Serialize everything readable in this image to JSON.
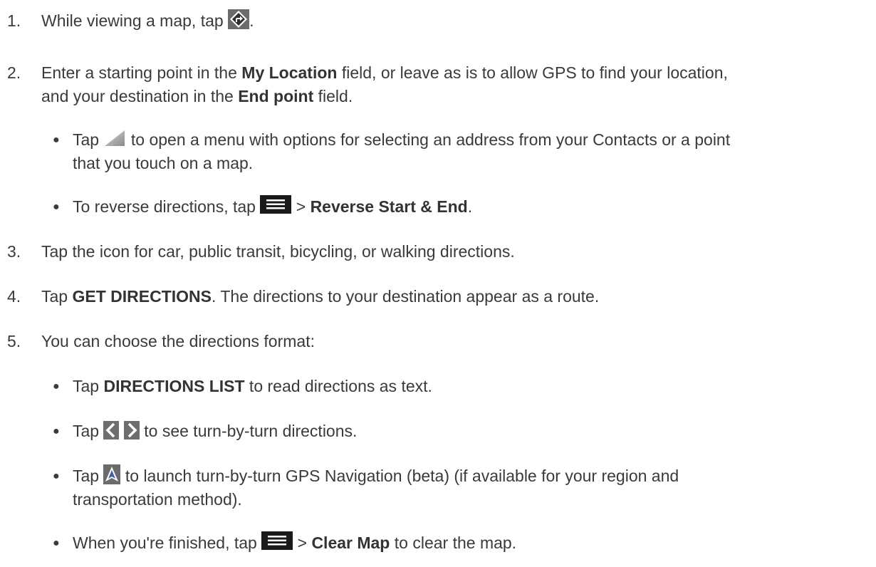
{
  "steps": [
    {
      "number": "1.",
      "text_before": "While viewing a map, tap",
      "icon": "directions-icon",
      "text_after": "."
    },
    {
      "number": "2.",
      "line1_a": "Enter a starting point in the ",
      "line1_bold": "My Location",
      "line1_b": " field, or leave as is to allow GPS to find your location,",
      "line2_a": "and your destination in the ",
      "line2_bold": "End point",
      "line2_b": " field.",
      "bullets": [
        {
          "text_before": "Tap",
          "icon": "contacts-triangle-icon",
          "text_after": " to open a menu with options for selecting an address from your Contacts or a point",
          "line2": "that you touch on a map."
        },
        {
          "text_before": "To reverse directions, tap",
          "icon": "menu-icon",
          "sep": " > ",
          "bold": "Reverse Start & End",
          "text_after": "."
        }
      ]
    },
    {
      "number": "3.",
      "text": "Tap the icon for car, public transit, bicycling, or walking directions."
    },
    {
      "number": "4.",
      "text_before": "Tap ",
      "bold": "GET DIRECTIONS",
      "text_after": ". The directions to your destination appear as a route."
    },
    {
      "number": "5.",
      "text": "You can choose the directions format:",
      "bullets": [
        {
          "text_before": "Tap ",
          "bold": "DIRECTIONS LIST",
          "text_after": " to read directions as text."
        },
        {
          "text_before": "Tap",
          "icon": "prev-next-arrows-icon",
          "text_after": " to see turn-by-turn directions."
        },
        {
          "text_before": "Tap",
          "icon": "navigation-arrow-icon",
          "text_after": " to launch turn-by-turn GPS Navigation (beta) (if available for your region and",
          "line2": "transportation method)."
        },
        {
          "text_before": "When you're finished, tap",
          "icon": "menu-icon",
          "sep": " > ",
          "bold": "Clear Map",
          "text_after": " to clear the map."
        }
      ]
    }
  ]
}
